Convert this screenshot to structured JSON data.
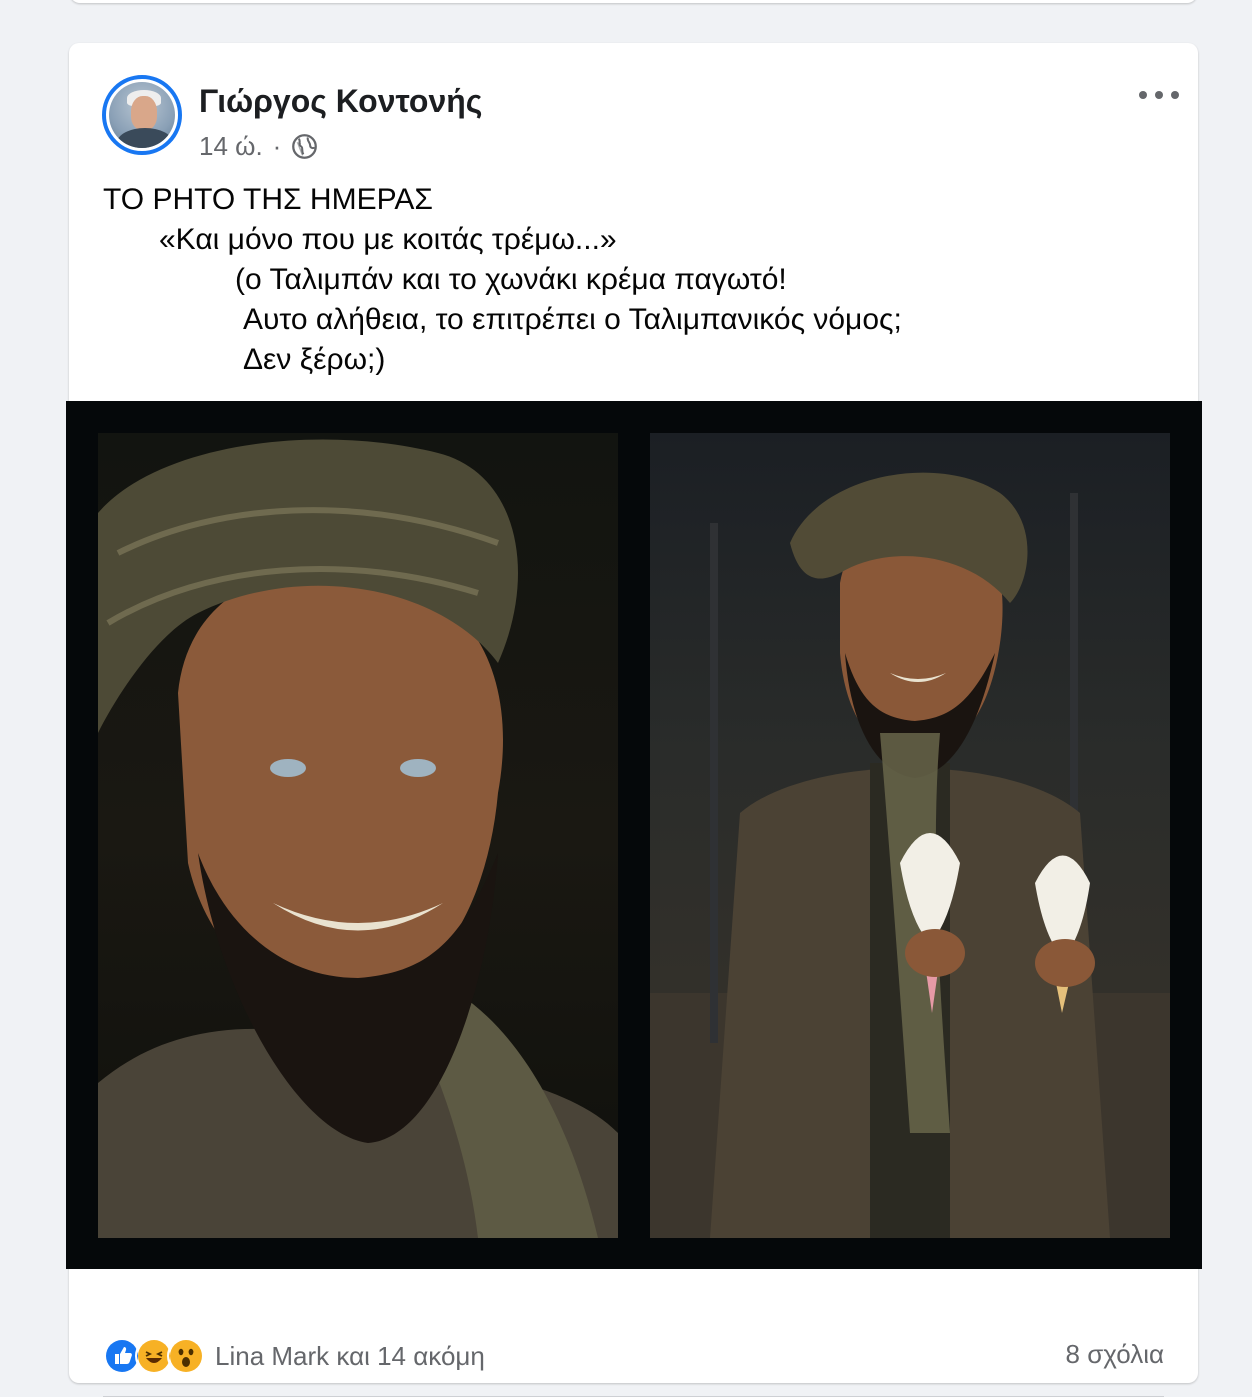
{
  "post": {
    "author": "Γιώργος Κοντονής",
    "time": "14 ώ.",
    "separator": "·",
    "visibility_icon": "globe-icon",
    "more_icon": "more-options-icon",
    "text_lines": [
      "ΤΟ ΡΗΤΟ ΤΗΣ ΗΜΕΡΑΣ",
      "«Και μόνο που με κοιτάς τρέμω...»",
      "(ο Ταλιμπάν και το χωνάκι κρέμα παγωτό!",
      "Αυτο αλήθεια, το επιτρέπει ο Ταλιμπανικός νόμος;",
      "Δεν ξέρω;)"
    ]
  },
  "footer": {
    "reaction_icons": [
      "like-icon",
      "haha-icon",
      "wow-icon"
    ],
    "reactions_label": "Lina Mark και 14 ακόμη",
    "comments_label": "8 σχόλια"
  },
  "colors": {
    "accent": "#1877f2",
    "secondary_text": "#65676b",
    "background": "#f0f2f5"
  }
}
